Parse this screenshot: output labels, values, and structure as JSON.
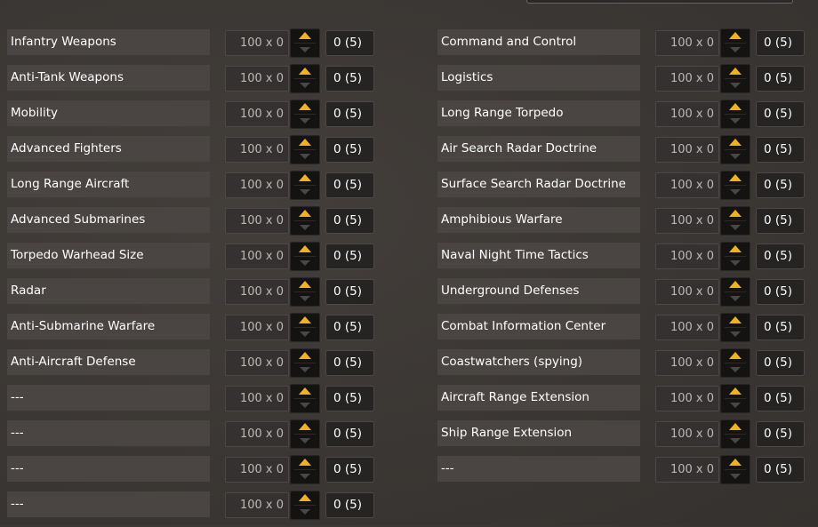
{
  "left_column": [
    {
      "label": "Infantry Weapons",
      "value": "100 x 0",
      "count": "0 (5)"
    },
    {
      "label": "Anti-Tank Weapons",
      "value": "100 x 0",
      "count": "0 (5)"
    },
    {
      "label": "Mobility",
      "value": "100 x 0",
      "count": "0 (5)"
    },
    {
      "label": "Advanced Fighters",
      "value": "100 x 0",
      "count": "0 (5)"
    },
    {
      "label": "Long Range Aircraft",
      "value": "100 x 0",
      "count": "0 (5)"
    },
    {
      "label": "Advanced Submarines",
      "value": "100 x 0",
      "count": "0 (5)"
    },
    {
      "label": "Torpedo Warhead Size",
      "value": "100 x 0",
      "count": "0 (5)"
    },
    {
      "label": "Radar",
      "value": "100 x 0",
      "count": "0 (5)"
    },
    {
      "label": "Anti-Submarine Warfare",
      "value": "100 x 0",
      "count": "0 (5)"
    },
    {
      "label": "Anti-Aircraft Defense",
      "value": "100 x 0",
      "count": "0 (5)"
    },
    {
      "label": "---",
      "value": "100 x 0",
      "count": "0 (5)"
    },
    {
      "label": "---",
      "value": "100 x 0",
      "count": "0 (5)"
    },
    {
      "label": "---",
      "value": "100 x 0",
      "count": "0 (5)"
    },
    {
      "label": "---",
      "value": "100 x 0",
      "count": "0 (5)"
    }
  ],
  "right_column": [
    {
      "label": "Command and Control",
      "value": "100 x 0",
      "count": "0 (5)"
    },
    {
      "label": "Logistics",
      "value": "100 x 0",
      "count": "0 (5)"
    },
    {
      "label": "Long Range Torpedo",
      "value": "100 x 0",
      "count": "0 (5)"
    },
    {
      "label": "Air Search Radar Doctrine",
      "value": "100 x 0",
      "count": "0 (5)"
    },
    {
      "label": "Surface Search Radar Doctrine",
      "value": "100 x 0",
      "count": "0 (5)"
    },
    {
      "label": "Amphibious Warfare",
      "value": "100 x 0",
      "count": "0 (5)"
    },
    {
      "label": "Naval Night Time Tactics",
      "value": "100 x 0",
      "count": "0 (5)"
    },
    {
      "label": "Underground Defenses",
      "value": "100 x 0",
      "count": "0 (5)"
    },
    {
      "label": "Combat Information Center",
      "value": "100 x 0",
      "count": "0 (5)"
    },
    {
      "label": "Coastwatchers (spying)",
      "value": "100 x 0",
      "count": "0 (5)"
    },
    {
      "label": "Aircraft Range Extension",
      "value": "100 x 0",
      "count": "0 (5)"
    },
    {
      "label": "Ship Range Extension",
      "value": "100 x 0",
      "count": "0 (5)"
    },
    {
      "label": "---",
      "value": "100 x 0",
      "count": "0 (5)"
    }
  ],
  "colors": {
    "background": "#3c3835",
    "label_bg": "#4a4542",
    "accent_arrow": "#f3b21b"
  },
  "icons": {
    "increase": "arrow-up-icon",
    "decrease": "arrow-down-icon"
  }
}
